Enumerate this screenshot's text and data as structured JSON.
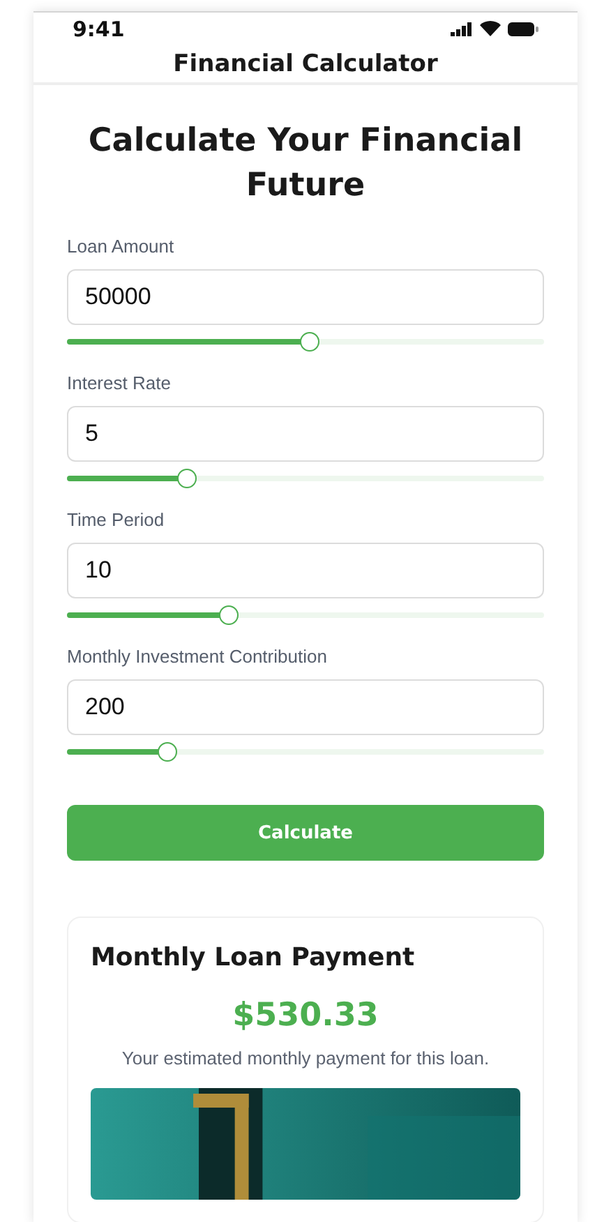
{
  "status_bar": {
    "time": "9:41"
  },
  "header": {
    "title": "Financial Calculator"
  },
  "heading": "Calculate Your Financial Future",
  "fields": [
    {
      "label": "Loan Amount",
      "value": "50000",
      "level": 0.51
    },
    {
      "label": "Interest Rate",
      "value": "5",
      "level": 0.25
    },
    {
      "label": "Time Period",
      "value": "10",
      "level": 0.34
    },
    {
      "label": "Monthly Investment Contribution",
      "value": "200",
      "level": 0.21
    }
  ],
  "calculate_button": "Calculate",
  "result": {
    "title": "Monthly Loan Payment",
    "amount": "$530.33",
    "description": "Your estimated monthly payment for this loan."
  }
}
